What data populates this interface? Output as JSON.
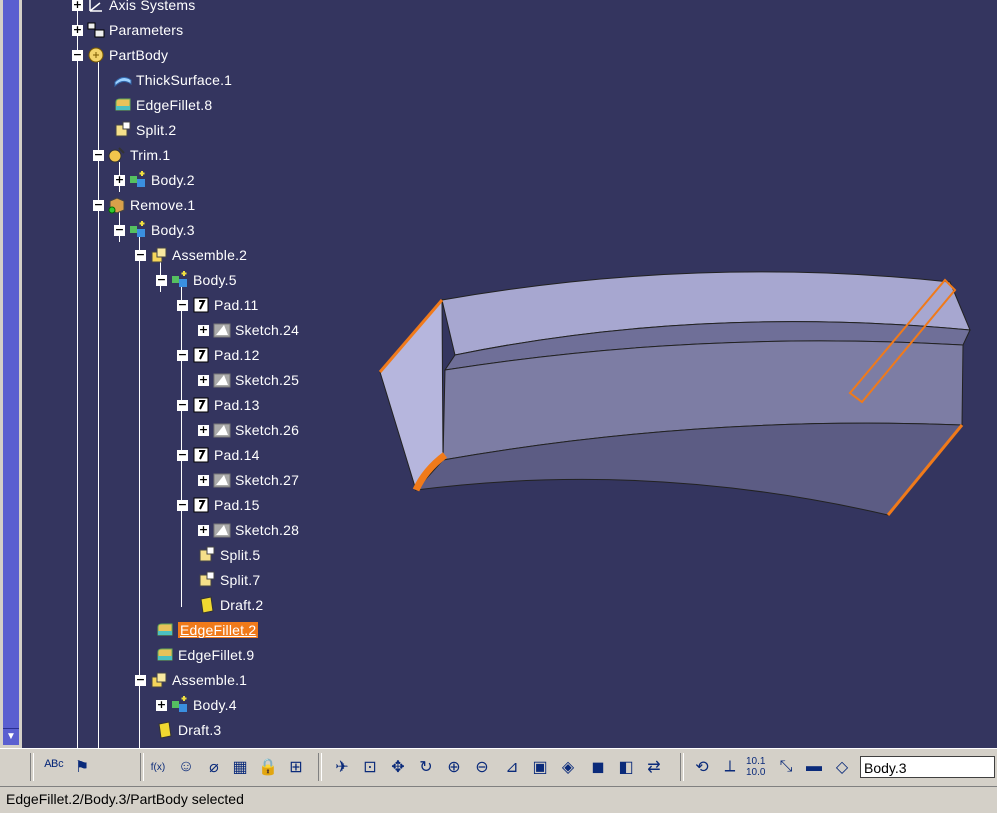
{
  "tree": {
    "nodes": [
      {
        "label": "Axis Systems",
        "icon": "axis-system-icon"
      },
      {
        "label": "Parameters",
        "icon": "parameters-icon"
      },
      {
        "label": "PartBody",
        "icon": "partbody-icon"
      },
      {
        "label": "ThickSurface.1",
        "icon": "thicksurface-icon"
      },
      {
        "label": "EdgeFillet.8",
        "icon": "edgefillet-icon"
      },
      {
        "label": "Split.2",
        "icon": "split-icon"
      },
      {
        "label": "Trim.1",
        "icon": "trim-icon"
      },
      {
        "label": "Body.2",
        "icon": "body-icon"
      },
      {
        "label": "Remove.1",
        "icon": "remove-icon"
      },
      {
        "label": "Body.3",
        "icon": "body-icon"
      },
      {
        "label": "Assemble.2",
        "icon": "assemble-icon"
      },
      {
        "label": "Body.5",
        "icon": "body-icon"
      },
      {
        "label": "Pad.11",
        "icon": "pad-icon"
      },
      {
        "label": "Sketch.24",
        "icon": "sketch-icon"
      },
      {
        "label": "Pad.12",
        "icon": "pad-icon"
      },
      {
        "label": "Sketch.25",
        "icon": "sketch-icon"
      },
      {
        "label": "Pad.13",
        "icon": "pad-icon"
      },
      {
        "label": "Sketch.26",
        "icon": "sketch-icon"
      },
      {
        "label": "Pad.14",
        "icon": "pad-icon"
      },
      {
        "label": "Sketch.27",
        "icon": "sketch-icon"
      },
      {
        "label": "Pad.15",
        "icon": "pad-icon"
      },
      {
        "label": "Sketch.28",
        "icon": "sketch-icon"
      },
      {
        "label": "Split.5",
        "icon": "split-icon"
      },
      {
        "label": "Split.7",
        "icon": "split-icon"
      },
      {
        "label": "Draft.2",
        "icon": "draft-icon"
      },
      {
        "label": "EdgeFillet.2",
        "icon": "edgefillet-icon",
        "selected": true
      },
      {
        "label": "EdgeFillet.9",
        "icon": "edgefillet-icon"
      },
      {
        "label": "Assemble.1",
        "icon": "assemble-icon"
      },
      {
        "label": "Body.4",
        "icon": "body-icon"
      },
      {
        "label": "Draft.3",
        "icon": "draft-icon"
      }
    ]
  },
  "toolbar": {
    "buttons": [
      {
        "icon": "abc-text-icon"
      },
      {
        "icon": "flag-note-icon"
      },
      {
        "icon": "formula-icon",
        "text": "f(x)"
      },
      {
        "icon": "knowledge-advisor-icon"
      },
      {
        "icon": "measure-icon"
      },
      {
        "icon": "table-icon"
      },
      {
        "icon": "lock-icon"
      },
      {
        "icon": "tree-expand-icon"
      },
      {
        "icon": "fly-mode-icon"
      },
      {
        "icon": "fit-all-icon"
      },
      {
        "icon": "pan-icon"
      },
      {
        "icon": "rotate-icon"
      },
      {
        "icon": "zoom-in-icon"
      },
      {
        "icon": "zoom-out-icon"
      },
      {
        "icon": "normal-view-icon"
      },
      {
        "icon": "multi-view-icon"
      },
      {
        "icon": "iso-view-icon"
      },
      {
        "icon": "shading-icon"
      },
      {
        "icon": "hide-show-icon"
      },
      {
        "icon": "swap-space-icon"
      },
      {
        "icon": "update-icon"
      },
      {
        "icon": "axis-icon"
      },
      {
        "icon": "precision-icon",
        "text": "10.1 10.0"
      },
      {
        "icon": "analysis-icon"
      },
      {
        "icon": "color-icon"
      },
      {
        "icon": "layer-icon"
      }
    ],
    "current_body": "Body.3"
  },
  "status": {
    "text": "EdgeFillet.2/Body.3/PartBody selected"
  },
  "colors": {
    "viewport_bg": "#34355f",
    "selection": "#f07a1a",
    "part_top": "#a9a9d2",
    "part_front": "#7878a0",
    "part_side": "#b4b4dc"
  }
}
